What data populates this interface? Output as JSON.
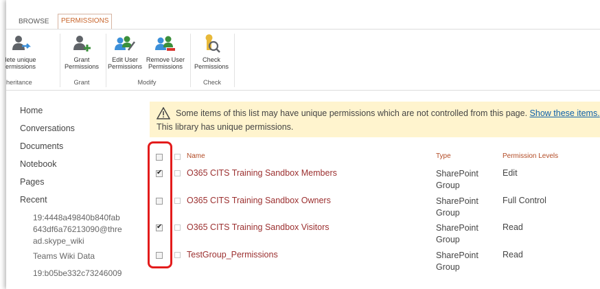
{
  "tabs": {
    "browse": "BROWSE",
    "permissions": "PERMISSIONS"
  },
  "ribbon": {
    "buttons": [
      {
        "label1": "lete unique",
        "label2": "ermissions",
        "icon": "delete-unique-permissions-icon"
      },
      {
        "label1": "Grant",
        "label2": "Permissions",
        "icon": "grant-permissions-icon"
      },
      {
        "label1": "Edit User",
        "label2": "Permissions",
        "icon": "edit-user-permissions-icon"
      },
      {
        "label1": "Remove User",
        "label2": "Permissions",
        "icon": "remove-user-permissions-icon"
      },
      {
        "label1": "Check",
        "label2": "Permissions",
        "icon": "check-permissions-icon"
      }
    ],
    "groups": {
      "inheritance": "heritance",
      "grant": "Grant",
      "modify": "Modify",
      "check": "Check"
    }
  },
  "nav": {
    "items": [
      "Home",
      "Conversations",
      "Documents",
      "Notebook",
      "Pages",
      "Recent"
    ],
    "recent": {
      "item1": [
        "19:4448a49840b840fab",
        "643df6a76213090@thre",
        "ad.skype_wiki"
      ],
      "item2": "Teams Wiki Data",
      "item3": "19:b05be332c73246009"
    }
  },
  "warning": {
    "text": "Some items of this list may have unique permissions which are not controlled from this page.",
    "link": "Show these items.",
    "line2": "This library has unique permissions."
  },
  "table": {
    "headers": {
      "name": "Name",
      "type": "Type",
      "level": "Permission Levels"
    },
    "rows": [
      {
        "name": "O365 CITS Training Sandbox Members",
        "type1": "SharePoint",
        "type2": "Group",
        "level": "Edit",
        "checked": true
      },
      {
        "name": "O365 CITS Training Sandbox Owners",
        "type1": "SharePoint",
        "type2": "Group",
        "level": "Full Control",
        "checked": false
      },
      {
        "name": "O365 CITS Training Sandbox Visitors",
        "type1": "SharePoint",
        "type2": "Group",
        "level": "Read",
        "checked": true
      },
      {
        "name": "TestGroup_Permissions",
        "type1": "SharePoint",
        "type2": "Group",
        "level": "Read",
        "checked": false
      }
    ]
  },
  "colors": {
    "accent": "#c8642a",
    "link": "#0a5fa8",
    "row_link": "#9b2f2f",
    "highlight": "#e31b1b",
    "warning_bg": "#fff4ce"
  }
}
